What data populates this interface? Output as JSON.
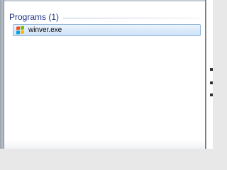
{
  "search_results": {
    "group": {
      "title": "Programs (1)"
    },
    "items": [
      {
        "label": "winver.exe",
        "icon": "windows-logo-icon",
        "selected": true
      }
    ]
  },
  "colors": {
    "group_title": "#1e3287",
    "selection_border": "#8fb5dc",
    "selection_fill": "#dbeafa"
  }
}
